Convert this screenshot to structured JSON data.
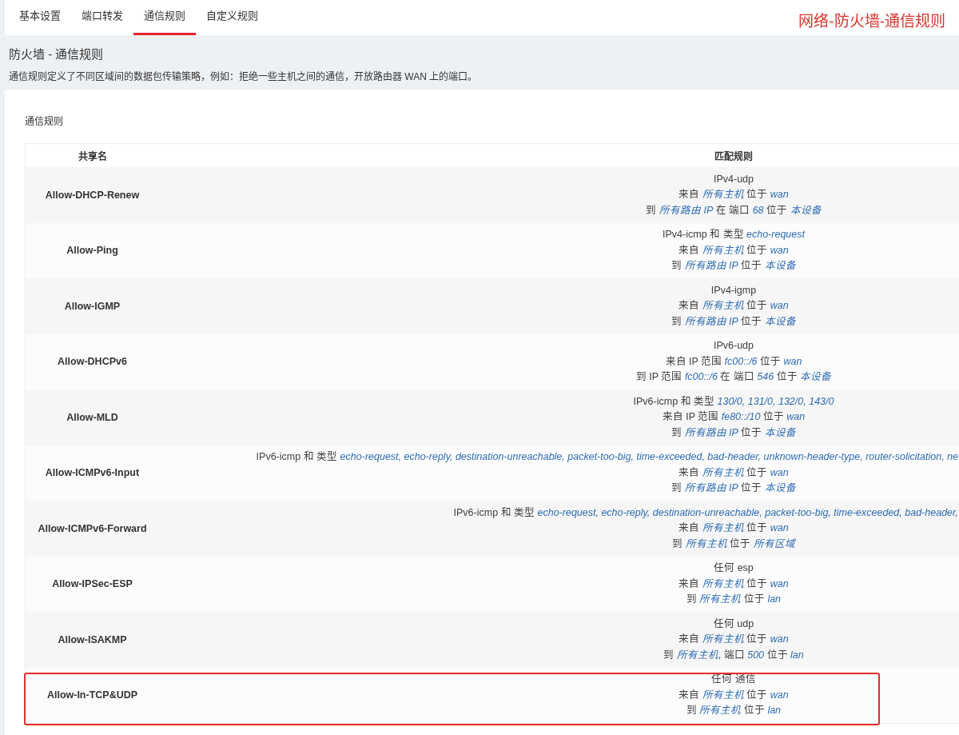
{
  "tabs": [
    {
      "label": "基本设置",
      "selected": false
    },
    {
      "label": "端口转发",
      "selected": false
    },
    {
      "label": "通信规则",
      "selected": true
    },
    {
      "label": "自定义规则",
      "selected": false
    }
  ],
  "annotation": {
    "text": "网络-防火墙-通信规则"
  },
  "page": {
    "title": "防火墙 - 通信规则",
    "description": "通信规则定义了不同区域间的数据包传输策略，例如：拒绝一些主机之间的通信，开放路由器 WAN 上的端口。"
  },
  "rules": {
    "section_title": "通信规则",
    "columns": [
      "共享名",
      "匹配规则"
    ],
    "rows": [
      {
        "name": "Allow-DHCP-Renew",
        "highlighted": false,
        "match": [
          "IPv4-udp",
          "来自 *所有主机* 位于 *wan*",
          "到 *所有路由 IP* 在 端口 *68* 位于 *本设备*"
        ]
      },
      {
        "name": "Allow-Ping",
        "highlighted": false,
        "match": [
          "IPv4-icmp 和 类型 *echo-request*",
          "来自 *所有主机* 位于 *wan*",
          "到 *所有路由 IP* 位于 *本设备*"
        ]
      },
      {
        "name": "Allow-IGMP",
        "highlighted": false,
        "match": [
          "IPv4-igmp",
          "来自 *所有主机* 位于 *wan*",
          "到 *所有路由 IP* 位于 *本设备*"
        ]
      },
      {
        "name": "Allow-DHCPv6",
        "highlighted": false,
        "match": [
          "IPv6-udp",
          "来自 IP 范围 *fc00::/6* 位于 *wan*",
          "到 IP 范围 *fc00::/6* 在 端口 *546* 位于 *本设备*"
        ]
      },
      {
        "name": "Allow-MLD",
        "highlighted": false,
        "match": [
          "IPv6-icmp 和 类型 *130/0, 131/0, 132/0, 143/0*",
          "来自 IP 范围 *fe80::/10* 位于 *wan*",
          "到 *所有路由 IP* 位于 *本设备*"
        ]
      },
      {
        "name": "Allow-ICMPv6-Input",
        "highlighted": false,
        "match": [
          "IPv6-icmp 和 类型 *echo-request, echo-reply, destination-unreachable, packet-too-big, time-exceeded, bad-header, unknown-header-type, router-solicitation, ne*",
          "来自 *所有主机* 位于 *wan*",
          "到 *所有路由 IP* 位于 *本设备*"
        ]
      },
      {
        "name": "Allow-ICMPv6-Forward",
        "highlighted": false,
        "match": [
          "IPv6-icmp 和 类型 *echo-request, echo-reply, destination-unreachable, packet-too-big, time-exceeded, bad-header,*",
          "来自 *所有主机* 位于 *wan*",
          "到 *所有主机* 位于 *所有区域*"
        ]
      },
      {
        "name": "Allow-IPSec-ESP",
        "highlighted": false,
        "match": [
          "任何 esp",
          "来自 *所有主机* 位于 *wan*",
          "到 *所有主机* 位于 *lan*"
        ]
      },
      {
        "name": "Allow-ISAKMP",
        "highlighted": false,
        "match": [
          "任何 udp",
          "来自 *所有主机* 位于 *wan*",
          "到 *所有主机*, 端口 *500* 位于 *lan*"
        ]
      },
      {
        "name": "Allow-In-TCP&UDP",
        "highlighted": true,
        "match": [
          "任何 通信",
          "来自 *所有主机* 位于 *wan*",
          "到 *所有主机* 位于 *lan*"
        ]
      }
    ]
  }
}
